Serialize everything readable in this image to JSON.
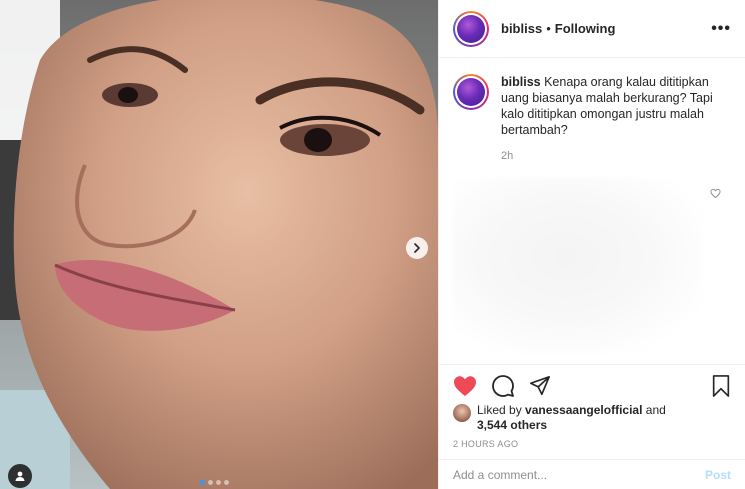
{
  "post": {
    "username": "bibliss",
    "follow_status": "Following",
    "separator": "•",
    "more_label": "•••",
    "caption": "Kenapa orang kalau dititipkan uang biasanya malah berkurang? Tapi kalo dititipkan omongan justru malah bertambah?",
    "caption_age": "2h",
    "liked_by_prefix": "Liked by",
    "liked_by_user": "vanessaangelofficial",
    "liked_by_and": "and",
    "others_count": "3,544 others",
    "posted_time": "2 HOURS AGO",
    "comment_placeholder": "Add a comment...",
    "post_label": "Post",
    "carousel_dots": 4,
    "carousel_active": 0
  },
  "icons": {
    "like": "heart-filled-icon",
    "comment": "comment-icon",
    "share": "share-icon",
    "save": "bookmark-icon",
    "next": "chevron-right-icon",
    "user_tag": "user-icon",
    "comment_like": "heart-outline-icon"
  },
  "colors": {
    "like_red": "#ed4956",
    "post_button_disabled": "#b2dffc",
    "carousel_active": "#3897f0",
    "muted_text": "#8e8e8e"
  }
}
